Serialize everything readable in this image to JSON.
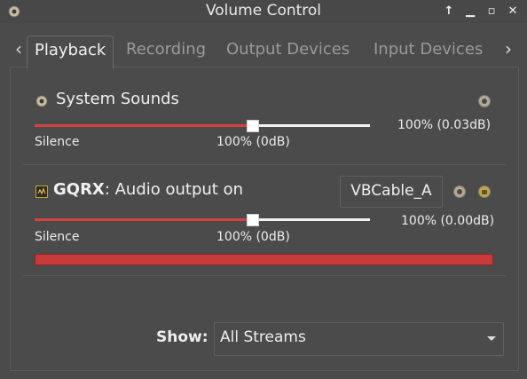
{
  "window": {
    "title": "Volume Control"
  },
  "tabs": [
    {
      "label": "Playback",
      "active": true
    },
    {
      "label": "Recording",
      "active": false
    },
    {
      "label": "Output Devices",
      "active": false
    },
    {
      "label": "Input Devices",
      "active": false
    }
  ],
  "streams": [
    {
      "name": "System Sounds",
      "volume_percent": 100,
      "volume_text": "100% (0.03dB)",
      "scale_min_label": "Silence",
      "scale_mark_label": "100% (0dB)"
    },
    {
      "app": "GQRX",
      "name_suffix": ": Audio output on",
      "device": "VBCable_A",
      "volume_percent": 100,
      "volume_text": "100% (0.00dB)",
      "scale_min_label": "Silence",
      "scale_mark_label": "100% (0dB)",
      "peak_level": 1.0
    }
  ],
  "footer": {
    "show_label": "Show:",
    "filter_value": "All Streams"
  },
  "colors": {
    "accent": "#d64141",
    "background": "#4b4b4b"
  }
}
